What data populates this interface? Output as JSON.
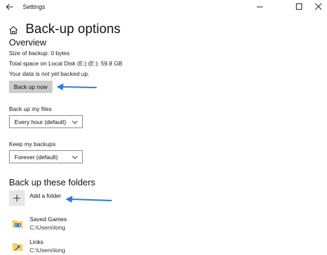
{
  "window": {
    "title": "Settings",
    "controls": {
      "back": "back-arrow-icon",
      "minimize": "minimize-icon",
      "maximize": "maximize-icon",
      "close": "close-icon"
    }
  },
  "page": {
    "title": "Back-up options",
    "home_icon": "home-icon"
  },
  "overview": {
    "heading": "Overview",
    "size_of_backup": "Size of backup: 0 bytes",
    "total_space": "Total space on Local Disk (E:) (E:): 59.8 GB",
    "status": "Your data is not yet backed up.",
    "backup_now_label": "Back up now"
  },
  "backup_frequency": {
    "label": "Back up my files",
    "selected": "Every hour (default)"
  },
  "keep_backups": {
    "label": "Keep my backups",
    "selected": "Forever (default)"
  },
  "folders": {
    "heading": "Back up these folders",
    "add_label": "Add a folder",
    "items": [
      {
        "name": "Saved Games",
        "path": "C:\\Users\\long",
        "icon": "saved-games-folder-icon"
      },
      {
        "name": "Links",
        "path": "C:\\Users\\long",
        "icon": "links-folder-icon"
      }
    ]
  },
  "colors": {
    "annotation_arrow": "#2b78e4",
    "button_bg": "#cccccc",
    "add_box_bg": "#e6e6e6"
  }
}
